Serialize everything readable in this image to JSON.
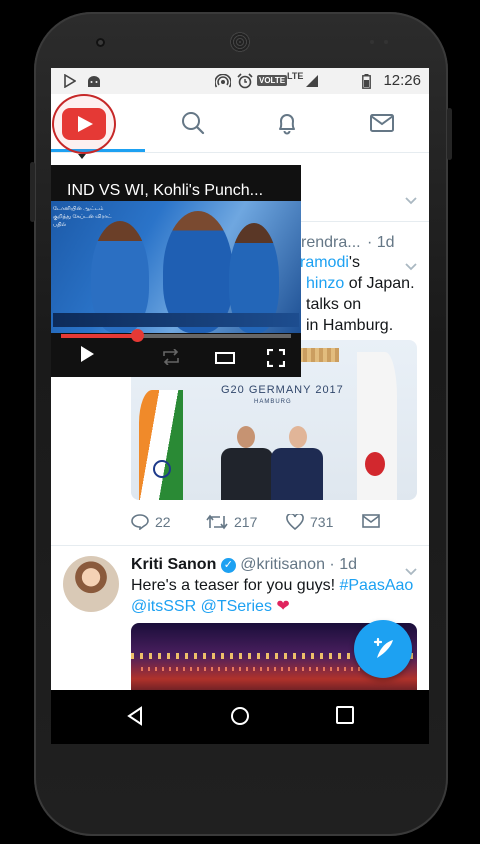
{
  "status_bar": {
    "network_badge": "VOLTE",
    "network_type": "LTE",
    "time": "12:26"
  },
  "icons": {
    "play_store": "play-store-icon",
    "android": "android-icon",
    "hotspot": "hotspot-icon",
    "alarm": "alarm-icon",
    "battery": "battery-icon",
    "youtube": "youtube-icon",
    "search": "search-icon",
    "notifications": "bell-icon",
    "messages": "mail-icon",
    "compose": "compose-tweet-icon"
  },
  "colors": {
    "twitter_blue": "#1da1f2",
    "youtube_red": "#e53935",
    "like_heart": "#e0245e"
  },
  "video": {
    "title": "IND VS WI, Kohli's Punch...",
    "tamil_caption": "டோனியின் ஆட்டம் குறித்து கேப்டன் விராட் பதில்",
    "progress_fraction": 0.33
  },
  "tweet1": {
    "author_fragment": "rendra...",
    "time": "· 1d",
    "line1_link": "ramodi",
    "line1_rest": "'s",
    "line2_link": "hinzo",
    "line2_rest": " of Japan.",
    "line3": "talks on",
    "line4": "in Hamburg.",
    "photo_banner": "G20 GERMANY 2017",
    "photo_sub": "HAMBURG",
    "replies": "22",
    "retweets": "217",
    "likes": "731"
  },
  "tweet2": {
    "author": "Kriti Sanon",
    "handle": "@kritisanon",
    "time": "· 1d",
    "text_part1": "Here's a teaser for you guys! ",
    "hashtag": "#PaasAao",
    "mention1": "@itsSSR",
    "mention2": " @TSeries",
    "heart": "❤"
  }
}
